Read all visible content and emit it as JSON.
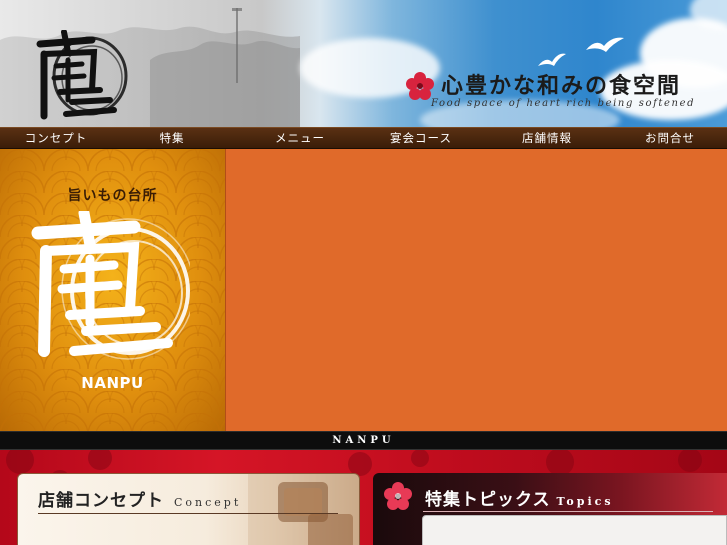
{
  "header": {
    "tagline_jp": "心豊かな和みの食空間",
    "tagline_en": "Food space of heart rich being softened"
  },
  "nav": {
    "items": [
      {
        "label": "コンセプト"
      },
      {
        "label": "特集"
      },
      {
        "label": "メニュー"
      },
      {
        "label": "宴会コース"
      },
      {
        "label": "店舗情報"
      },
      {
        "label": "お問合せ"
      }
    ]
  },
  "hero": {
    "subtitle": "旨いもの台所",
    "name": "NANPU"
  },
  "band": {
    "text": "NANPU"
  },
  "concept": {
    "title": "店舗コンセプト",
    "title_en": "Concept"
  },
  "topics": {
    "title": "特集トピックス",
    "title_en": "Topics"
  },
  "colors": {
    "nav_bg": "#4a260d",
    "hero_orange": "#e06a2a",
    "hero_gold": "#e8980f",
    "bottom_red": "#c80f20",
    "hibiscus": "#d8233e"
  }
}
